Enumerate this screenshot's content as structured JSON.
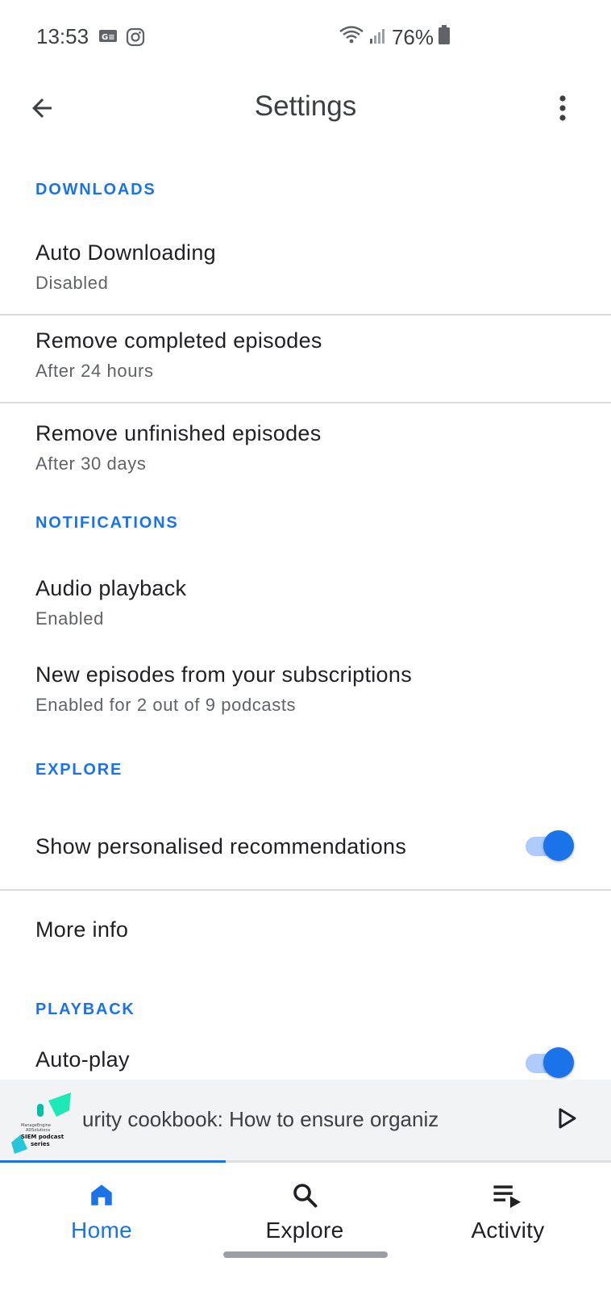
{
  "status_bar": {
    "time": "13:53",
    "battery": "76%",
    "left_icons": [
      "news-badge-icon",
      "instagram-icon"
    ],
    "right_icons": [
      "wifi-icon",
      "signal-icon",
      "battery-icon"
    ]
  },
  "app_bar": {
    "title": "Settings",
    "back_icon": "arrow-back-icon",
    "menu_icon": "more-vert-icon"
  },
  "sections": {
    "downloads": {
      "header": "DOWNLOADS",
      "items": [
        {
          "title": "Auto Downloading",
          "subtitle": "Disabled"
        },
        {
          "title": "Remove completed episodes",
          "subtitle": "After 24 hours"
        },
        {
          "title": "Remove unfinished episodes",
          "subtitle": "After 30 days"
        }
      ]
    },
    "notifications": {
      "header": "NOTIFICATIONS",
      "items": [
        {
          "title": "Audio playback",
          "subtitle": "Enabled"
        },
        {
          "title": "New episodes from your subscriptions",
          "subtitle": "Enabled for 2 out of 9 podcasts"
        }
      ]
    },
    "explore": {
      "header": "EXPLORE",
      "items": [
        {
          "title": "Show personalised recommendations",
          "toggle_on": true
        },
        {
          "title": "More info"
        }
      ]
    },
    "playback": {
      "header": "PLAYBACK",
      "items": [
        {
          "title": "Auto-play",
          "toggle_on": true
        }
      ]
    }
  },
  "mini_player": {
    "episode_text": "urity cookbook: How to ensure organiz",
    "artwork_label": "SIEM podcast series",
    "play_icon": "play-arrow-icon",
    "progress_fraction": 0.37
  },
  "bottom_nav": {
    "items": [
      {
        "label": "Home",
        "icon": "home-icon",
        "active": true
      },
      {
        "label": "Explore",
        "icon": "search-icon",
        "active": false
      },
      {
        "label": "Activity",
        "icon": "playlist-play-icon",
        "active": false
      }
    ]
  },
  "colors": {
    "accent": "#1a73e8",
    "toggle_track": "#aecbfa",
    "divider": "#dadce0",
    "mini_player_bg": "#f1f3f4"
  }
}
